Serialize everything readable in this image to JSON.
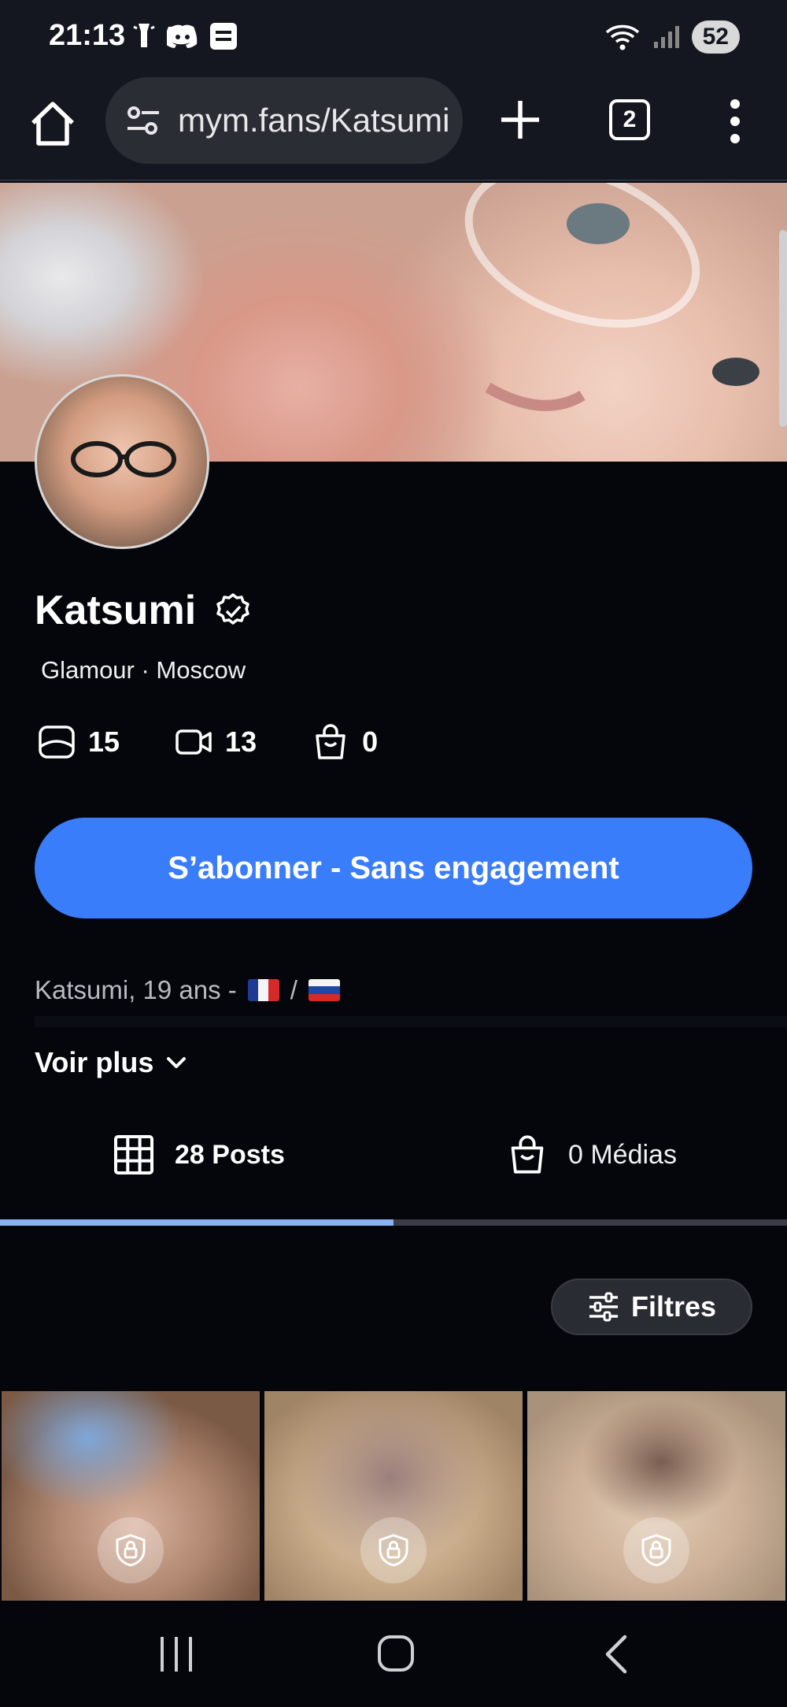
{
  "status_bar": {
    "time": "21:13",
    "left_icons": [
      "flashlight-icon",
      "discord-icon",
      "message-icon"
    ],
    "right_icons": [
      "wifi-icon",
      "signal-icon"
    ],
    "battery": "52"
  },
  "browser": {
    "url": "mym.fans/Katsumi",
    "tab_count": "2"
  },
  "profile": {
    "name": "Katsumi",
    "subtitle": "Glamour · Moscow",
    "stats": [
      {
        "icon": "photo-icon",
        "value": "15"
      },
      {
        "icon": "video-icon",
        "value": "13"
      },
      {
        "icon": "shopping-bag-icon",
        "value": "0"
      }
    ],
    "subscribe_label": "S’abonner - Sans engagement",
    "bio": "Katsumi, 19 ans -",
    "bio_separator": "/",
    "flags": [
      "france-flag",
      "russia-flag"
    ],
    "see_more": "Voir plus"
  },
  "tabs": [
    {
      "label": "28 Posts",
      "icon": "grid-icon",
      "active": true
    },
    {
      "label": "0 Médias",
      "icon": "shopping-bag-icon",
      "active": false
    }
  ],
  "filter_label": "Filtres",
  "colors": {
    "accent": "#3a7dfb",
    "tab_indicator": "#8ab1f2",
    "background": "#05060b"
  }
}
